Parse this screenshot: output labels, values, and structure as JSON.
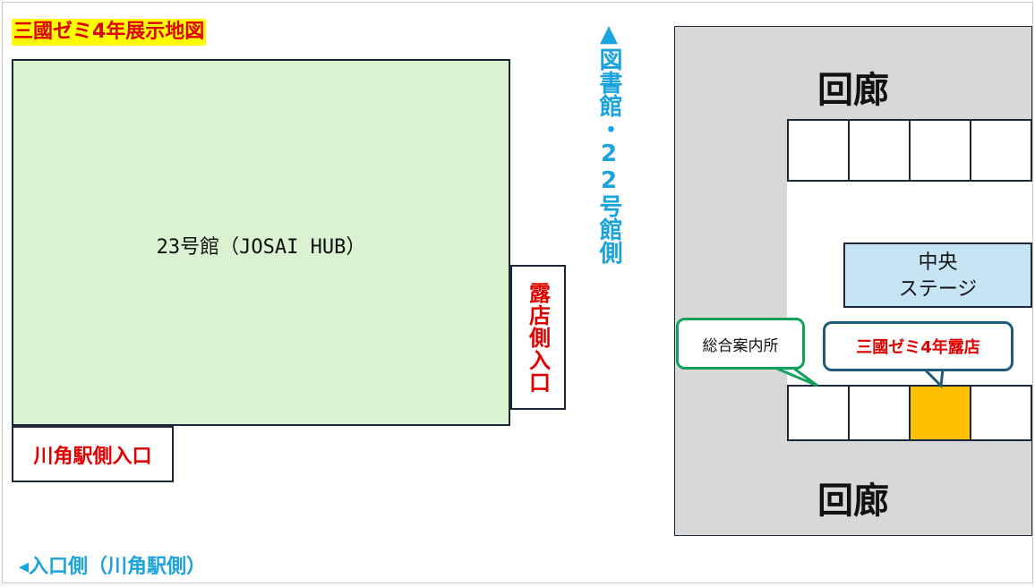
{
  "title": "三國ゼミ4年展示地図",
  "building": {
    "label": "23号館（JOSAI HUB）"
  },
  "entrances": {
    "stall_side": "露店側入口",
    "kawakado_side": "川角駅側入口"
  },
  "directions": {
    "library": "▲図書館・22号館側",
    "entrance_side": "◂入口側（川角駅側）"
  },
  "corridor": {
    "top_label": "回廊",
    "bottom_label": "回廊",
    "stage_line1": "中央",
    "stage_line2": "ステージ",
    "info_desk": "総合案内所",
    "stall": "三國ゼミ4年露店"
  },
  "colors": {
    "title_bg": "#ffff00",
    "title_text": "#e00000",
    "building_fill": "#d9f2d0",
    "direction_text": "#1aa3dc",
    "stage_fill": "#c5e4f4",
    "stall_highlight": "#ffc000",
    "corridor_fill": "#d8d8d8",
    "info_border": "#12a05a",
    "stall_border": "#1d5c7a"
  }
}
